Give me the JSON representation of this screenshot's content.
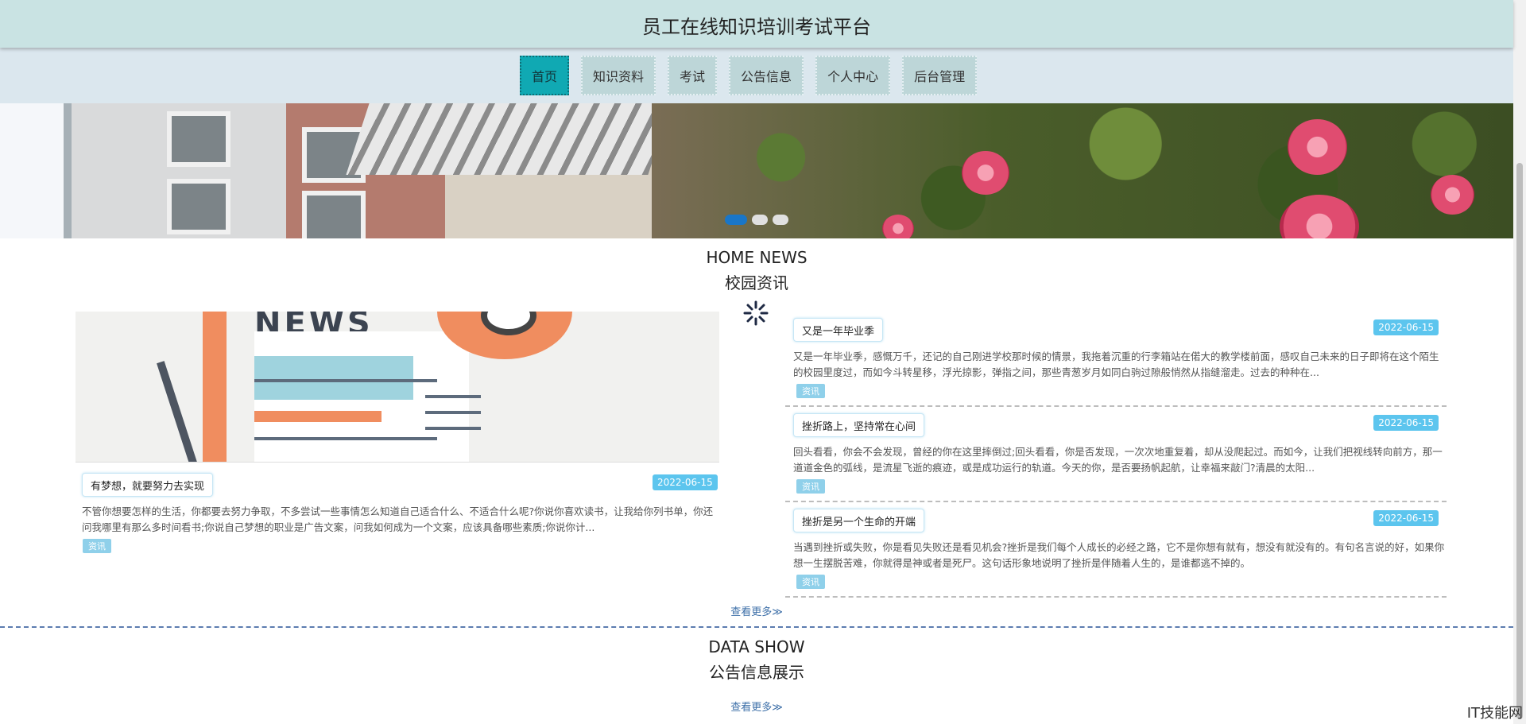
{
  "header": {
    "title": "员工在线知识培训考试平台"
  },
  "nav": {
    "items": [
      {
        "label": "首页"
      },
      {
        "label": "知识资料"
      },
      {
        "label": "考试"
      },
      {
        "label": "公告信息"
      },
      {
        "label": "个人中心"
      },
      {
        "label": "后台管理"
      }
    ],
    "active_index": 0
  },
  "banner": {
    "slide_count": 3,
    "active_slide": 0
  },
  "news_section": {
    "title_en": "HOME NEWS",
    "title_cn": "校园资讯",
    "featured": {
      "title": "有梦想，就要努力去实现",
      "date": "2022-06-15",
      "summary": "不管你想要怎样的生活，你都要去努力争取，不多尝试一些事情怎么知道自己适合什么、不适合什么呢?你说你喜欢读书，让我给你列书单，你还问我哪里有那么多时间看书;你说自己梦想的职业是广告文案，问我如何成为一个文案，应该具备哪些素质;你说你计...",
      "tag": "资讯"
    },
    "list": [
      {
        "title": "又是一年毕业季",
        "date": "2022-06-15",
        "summary": "又是一年毕业季，感慨万千，还记的自己刚进学校那时候的情景，我拖着沉重的行李箱站在偌大的教学楼前面，感叹自己未来的日子即将在这个陌生的校园里度过，而如今斗转星移，浮光掠影，弹指之间，那些青葱岁月如同白驹过隙般悄然从指缝溜走。过去的种种在...",
        "tag": "资讯"
      },
      {
        "title": "挫折路上，坚持常在心间",
        "date": "2022-06-15",
        "summary": "回头看看，你会不会发现，曾经的你在这里摔倒过;回头看看，你是否发现，一次次地重复着，却从没爬起过。而如今，让我们把视线转向前方，那一道道金色的弧线，是流星飞逝的痕迹，或是成功运行的轨道。今天的你，是否要扬帆起航，让幸福来敲门?清晨的太阳...",
        "tag": "资讯"
      },
      {
        "title": "挫折是另一个生命的开端",
        "date": "2022-06-15",
        "summary": "当遇到挫折或失败，你是看见失败还是看见机会?挫折是我们每个人成长的必经之路，它不是你想有就有，想没有就没有的。有句名言说的好，如果你想一生摆脱苦难，你就得是神或者是死尸。这句话形象地说明了挫折是伴随着人生的，是谁都逃不掉的。",
        "tag": "资讯"
      }
    ],
    "more": "查看更多≫"
  },
  "data_section": {
    "title_en": "DATA SHOW",
    "title_cn": "公告信息展示",
    "more": "查看更多≫"
  },
  "watermark": "IT技能网",
  "colors": {
    "header_bg": "#c9e3e3",
    "nav_bg": "#dbe7ee",
    "nav_active": "#10a9b3",
    "date_badge": "#5cc5ee",
    "tag": "#8fd0ea"
  }
}
